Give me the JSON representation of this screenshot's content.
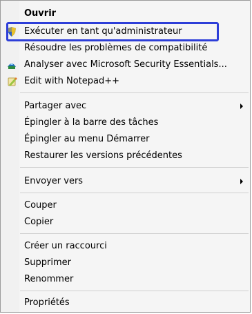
{
  "menu": {
    "items": [
      {
        "label": "Ouvrir"
      },
      {
        "label": "Exécuter en tant qu'administrateur"
      },
      {
        "label": "Résoudre les problèmes de compatibilité"
      },
      {
        "label": "Analyser avec Microsoft Security Essentials..."
      },
      {
        "label": "Edit with Notepad++"
      },
      {
        "label": "Partager avec"
      },
      {
        "label": "Épingler à la barre des tâches"
      },
      {
        "label": "Épingler au menu Démarrer"
      },
      {
        "label": "Restaurer les versions précédentes"
      },
      {
        "label": "Envoyer vers"
      },
      {
        "label": "Couper"
      },
      {
        "label": "Copier"
      },
      {
        "label": "Créer un raccourci"
      },
      {
        "label": "Supprimer"
      },
      {
        "label": "Renommer"
      },
      {
        "label": "Propriétés"
      }
    ]
  },
  "icons": {
    "run_as_admin": "shield-icon",
    "security_essentials": "security-essentials-icon",
    "notepad": "notepad-plus-plus-icon"
  },
  "colors": {
    "highlight_border": "#2d3ed8"
  }
}
